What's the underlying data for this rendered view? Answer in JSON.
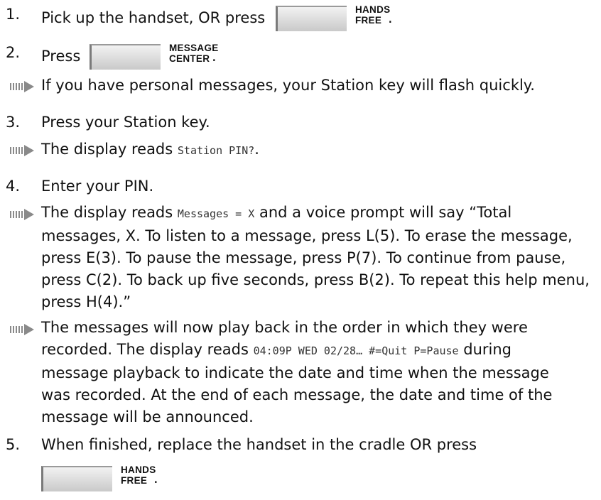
{
  "steps": [
    {
      "num": "1.",
      "pre": "Pick up the handset, OR press",
      "key": [
        "HANDS",
        "FREE"
      ],
      "post": "."
    },
    {
      "num": "2.",
      "pre": "Press",
      "key": [
        "MESSAGE",
        "CENTER"
      ],
      "post": "."
    },
    {
      "note": "If you have personal messages, your Station key will flash quickly."
    },
    {
      "num": "3.",
      "text": "Press your Station key."
    },
    {
      "note_pre": "The display reads",
      "note_code": "Station PIN?",
      "note_post": "."
    },
    {
      "num": "4.",
      "text": "Enter your PIN."
    },
    {
      "note_pre": "The display reads",
      "note_code": "Messages = X",
      "note_post": "and a voice prompt will say “Total messages, X. To listen to a message, press L(5). To erase the message, press E(3). To pause the message, press P(7). To continue from pause, press C(2). To back up five seconds, press B(2). To repeat this help menu, press H(4).”"
    },
    {
      "note_pre": "The messages will now play back in the order in which they were recorded. The display reads",
      "note_code": "04:09P WED 02/28… #=Quit P=Pause",
      "note_post": "during message playback to indicate the date and time when the message was recorded. At the end of each message, the date and time of the message will be announced."
    },
    {
      "num": "5.",
      "text": "When finished, replace the handset in the cradle OR press",
      "key": [
        "HANDS",
        "FREE"
      ],
      "post": "."
    }
  ]
}
